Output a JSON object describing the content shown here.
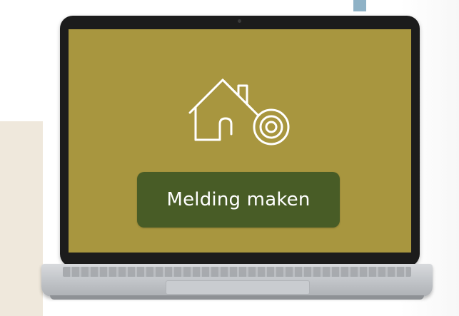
{
  "colors": {
    "screen_background": "#a8963f",
    "button_background": "#485c26",
    "button_text": "#ffffff",
    "icon_stroke": "#ffffff"
  },
  "screen": {
    "icon": "house-with-target-icon",
    "button_label": "Melding maken"
  }
}
